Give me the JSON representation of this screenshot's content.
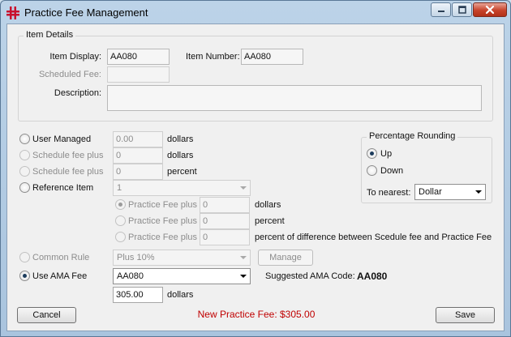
{
  "window": {
    "title": "Practice Fee Management"
  },
  "item_details": {
    "legend": "Item Details",
    "item_display_label": "Item Display:",
    "item_display_value": "AA080",
    "item_number_label": "Item Number:",
    "item_number_value": "AA080",
    "scheduled_fee_label": "Scheduled Fee:",
    "scheduled_fee_value": "",
    "description_label": "Description:",
    "description_value": ""
  },
  "options": {
    "user_managed": {
      "label": "User Managed",
      "value": "0.00",
      "unit": "dollars"
    },
    "schedule_fee_plus_dollars": {
      "label": "Schedule fee plus",
      "value": "0",
      "unit": "dollars"
    },
    "schedule_fee_plus_percent": {
      "label": "Schedule fee plus",
      "value": "0",
      "unit": "percent"
    },
    "reference_item": {
      "label": "Reference Item",
      "value": "1"
    },
    "practice_fee_plus_dollars": {
      "label": "Practice Fee plus",
      "value": "0",
      "unit": "dollars"
    },
    "practice_fee_plus_percent": {
      "label": "Practice Fee plus",
      "value": "0",
      "unit": "percent"
    },
    "practice_fee_plus_diff": {
      "label": "Practice Fee plus",
      "value": "0",
      "unit": "percent of difference between Scedule fee and Practice Fee"
    },
    "common_rule": {
      "label": "Common Rule",
      "value": "Plus 10%",
      "manage_label": "Manage"
    },
    "use_ama_fee": {
      "label": "Use AMA Fee",
      "value": "AA080",
      "amount": "305.00",
      "unit": "dollars"
    }
  },
  "suggested": {
    "label": "Suggested AMA Code:",
    "code": "AA080"
  },
  "rounding": {
    "legend": "Percentage Rounding",
    "up_label": "Up",
    "down_label": "Down",
    "nearest_label": "To nearest:",
    "nearest_value": "Dollar"
  },
  "footer": {
    "cancel_label": "Cancel",
    "save_label": "Save",
    "new_fee_text": "New Practice Fee: $305.00"
  },
  "colors": {
    "new_fee": "#c00000"
  }
}
